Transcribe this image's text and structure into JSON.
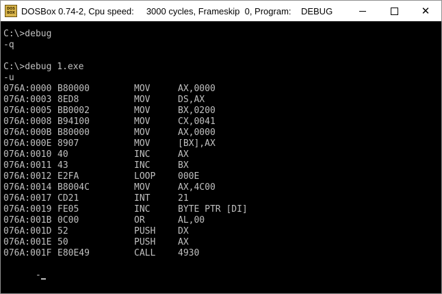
{
  "window": {
    "icon_text_top": "DOS",
    "icon_text_bottom": "BOX",
    "title": "DOSBox 0.74-2, Cpu speed:     3000 cycles, Frameskip  0, Program:    DEBUG",
    "controls": {
      "minimize": "—",
      "maximize": "☐",
      "close": "✕"
    }
  },
  "console": {
    "session1": {
      "command": "C:\\>debug",
      "quit": "-q"
    },
    "session2": {
      "command": "C:\\>debug 1.exe",
      "unassemble": "-u",
      "instructions": [
        {
          "addr": "076A:0000",
          "bytes": "B80000",
          "mnemonic": "MOV",
          "operands": "AX,0000"
        },
        {
          "addr": "076A:0003",
          "bytes": "8ED8",
          "mnemonic": "MOV",
          "operands": "DS,AX"
        },
        {
          "addr": "076A:0005",
          "bytes": "BB0002",
          "mnemonic": "MOV",
          "operands": "BX,0200"
        },
        {
          "addr": "076A:0008",
          "bytes": "B94100",
          "mnemonic": "MOV",
          "operands": "CX,0041"
        },
        {
          "addr": "076A:000B",
          "bytes": "B80000",
          "mnemonic": "MOV",
          "operands": "AX,0000"
        },
        {
          "addr": "076A:000E",
          "bytes": "8907",
          "mnemonic": "MOV",
          "operands": "[BX],AX"
        },
        {
          "addr": "076A:0010",
          "bytes": "40",
          "mnemonic": "INC",
          "operands": "AX"
        },
        {
          "addr": "076A:0011",
          "bytes": "43",
          "mnemonic": "INC",
          "operands": "BX"
        },
        {
          "addr": "076A:0012",
          "bytes": "E2FA",
          "mnemonic": "LOOP",
          "operands": "000E"
        },
        {
          "addr": "076A:0014",
          "bytes": "B8004C",
          "mnemonic": "MOV",
          "operands": "AX,4C00"
        },
        {
          "addr": "076A:0017",
          "bytes": "CD21",
          "mnemonic": "INT",
          "operands": "21"
        },
        {
          "addr": "076A:0019",
          "bytes": "FE05",
          "mnemonic": "INC",
          "operands": "BYTE PTR [DI]"
        },
        {
          "addr": "076A:001B",
          "bytes": "0C00",
          "mnemonic": "OR",
          "operands": "AL,00"
        },
        {
          "addr": "076A:001D",
          "bytes": "52",
          "mnemonic": "PUSH",
          "operands": "DX"
        },
        {
          "addr": "076A:001E",
          "bytes": "50",
          "mnemonic": "PUSH",
          "operands": "AX"
        },
        {
          "addr": "076A:001F",
          "bytes": "E80E49",
          "mnemonic": "CALL",
          "operands": "4930"
        }
      ],
      "prompt": "-"
    }
  }
}
